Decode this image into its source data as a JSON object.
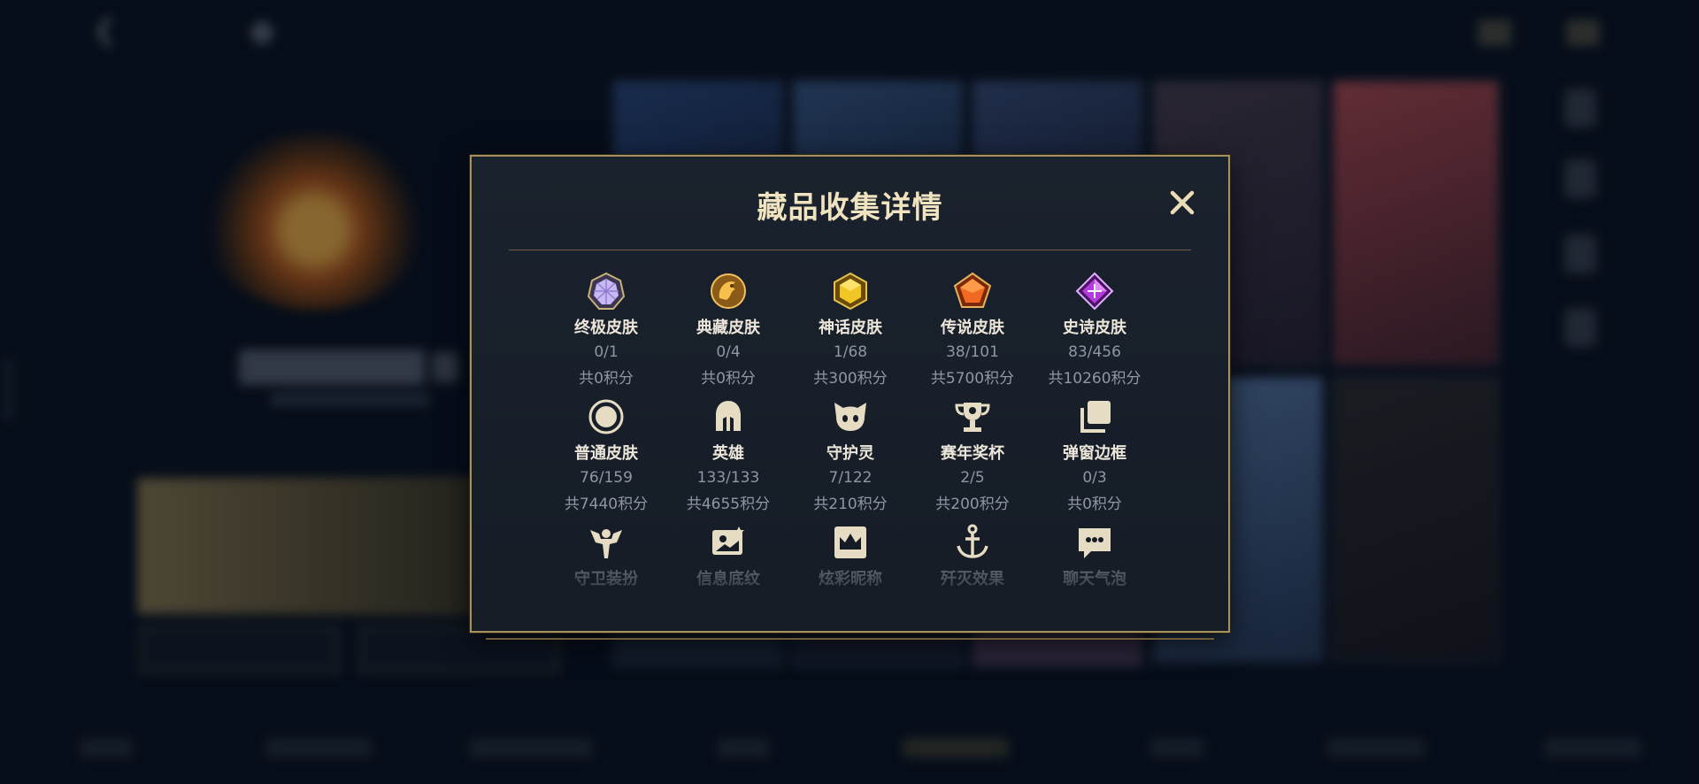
{
  "modal": {
    "title": "藏品收集详情"
  },
  "colors": {
    "gold_border": "#a8905c",
    "title": "#efe3c0",
    "muted": "#8f97a4",
    "bg": "#0a1221"
  },
  "rows": [
    [
      {
        "icon": "ultimate-skin-icon",
        "label": "终极皮肤",
        "count": "0/1",
        "score": "共0积分"
      },
      {
        "icon": "prestige-skin-icon",
        "label": "典藏皮肤",
        "count": "0/4",
        "score": "共0积分"
      },
      {
        "icon": "mythic-skin-icon",
        "label": "神话皮肤",
        "count": "1/68",
        "score": "共300积分"
      },
      {
        "icon": "legendary-skin-icon",
        "label": "传说皮肤",
        "count": "38/101",
        "score": "共5700积分"
      },
      {
        "icon": "epic-skin-icon",
        "label": "史诗皮肤",
        "count": "83/456",
        "score": "共10260积分"
      }
    ],
    [
      {
        "icon": "common-skin-icon",
        "label": "普通皮肤",
        "count": "76/159",
        "score": "共7440积分"
      },
      {
        "icon": "champion-helmet-icon",
        "label": "英雄",
        "count": "133/133",
        "score": "共4655积分"
      },
      {
        "icon": "guardian-sprite-icon",
        "label": "守护灵",
        "count": "7/122",
        "score": "共210积分"
      },
      {
        "icon": "trophy-icon",
        "label": "赛年奖杯",
        "count": "2/5",
        "score": "共200积分"
      },
      {
        "icon": "popup-frame-icon",
        "label": "弹窗边框",
        "count": "0/3",
        "score": "共0积分"
      }
    ],
    [
      {
        "icon": "ward-skin-icon",
        "label": "守卫装扮"
      },
      {
        "icon": "info-pattern-icon",
        "label": "信息底纹"
      },
      {
        "icon": "crown-nickname-icon",
        "label": "炫彩昵称"
      },
      {
        "icon": "anchor-ace-icon",
        "label": "歼灭效果"
      },
      {
        "icon": "chat-bubble-icon",
        "label": "聊天气泡"
      }
    ]
  ]
}
